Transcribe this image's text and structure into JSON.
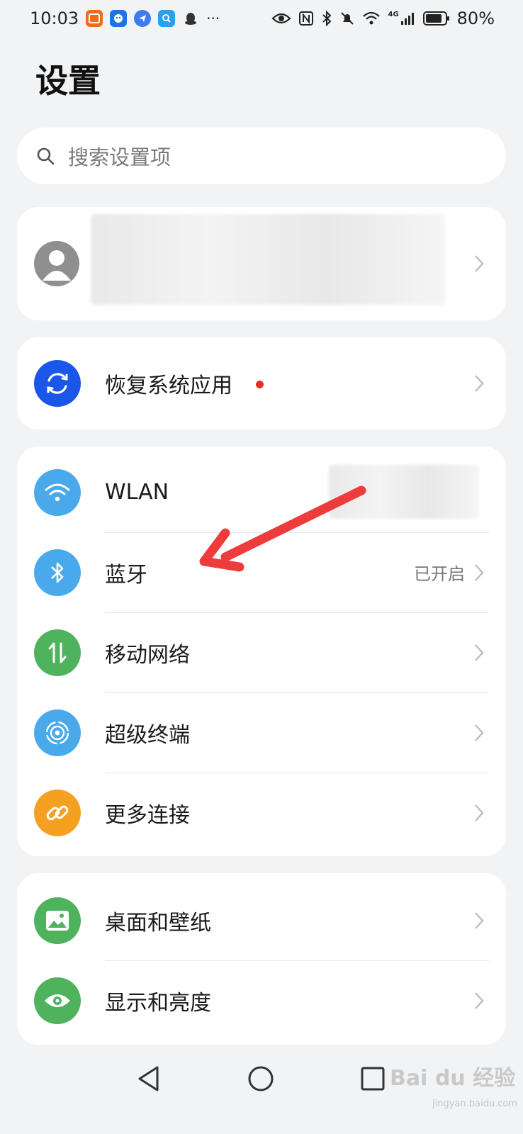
{
  "status_bar": {
    "time": "10:03",
    "more": "···",
    "network": "4G",
    "battery": "80%"
  },
  "page": {
    "title": "设置"
  },
  "search": {
    "placeholder": "搜索设置项"
  },
  "restore": {
    "label": "恢复系统应用"
  },
  "connections": {
    "wlan": "WLAN",
    "bluetooth": "蓝牙",
    "bluetooth_status": "已开启",
    "mobile_network": "移动网络",
    "super_device": "超级终端",
    "more_connections": "更多连接"
  },
  "display": {
    "wallpaper": "桌面和壁纸",
    "brightness": "显示和亮度"
  },
  "watermark": {
    "brand": "Bai du 经验",
    "url": "jingyan.baidu.com"
  },
  "colors": {
    "background": "#f1f3f5",
    "card": "#ffffff",
    "restore_blue": "#1a56e8",
    "wlan_blue": "#4aa9ea",
    "mobile_green": "#4fb35e",
    "more_orange": "#f5a020",
    "arrow_red": "#ee3b3b",
    "badge_red": "#e8311e"
  }
}
